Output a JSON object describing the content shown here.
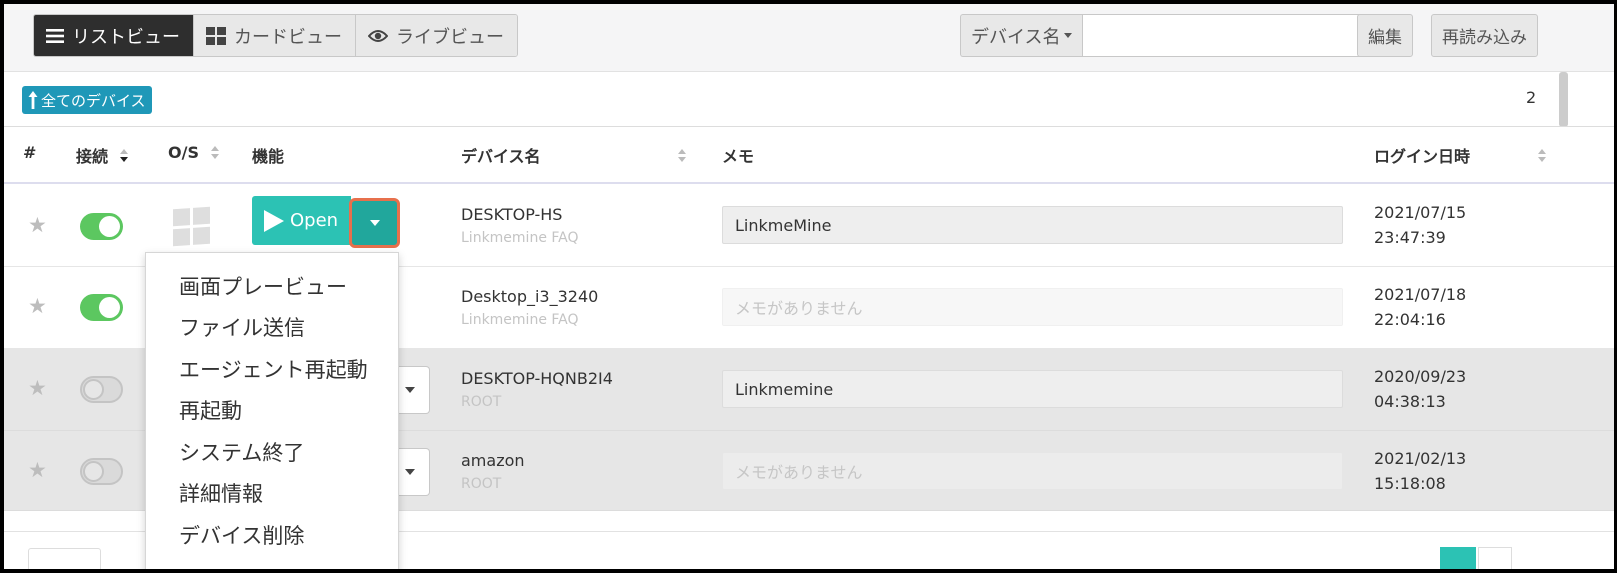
{
  "toolbar": {
    "views": [
      {
        "label": "リストビュー",
        "icon": "list-icon",
        "active": true
      },
      {
        "label": "カードビュー",
        "icon": "grid-icon",
        "active": false
      },
      {
        "label": "ライブビュー",
        "icon": "eye-icon",
        "active": false
      }
    ],
    "search_field_label": "デバイス名",
    "search_value": "",
    "edit_label": "編集",
    "reload_label": "再読み込み"
  },
  "all_devices_label": "全てのデバイス",
  "device_count": "2",
  "columns": {
    "num": "#",
    "connection": "接続",
    "os": "O/S",
    "function": "機能",
    "device_name": "デバイス名",
    "memo": "メモ",
    "login": "ログイン日時"
  },
  "open_label": "Open",
  "rows": [
    {
      "online": true,
      "name": "DESKTOP-HS",
      "sub": "Linkmemine FAQ",
      "memo": "LinkmeMine",
      "date": "2021/07/15",
      "time": "23:47:39"
    },
    {
      "online": true,
      "name": "Desktop_i3_3240",
      "sub": "Linkmemine FAQ",
      "memo": "メモがありません",
      "date": "2021/07/18",
      "time": "22:04:16"
    },
    {
      "online": false,
      "name": "DESKTOP-HQNB2I4",
      "sub": "ROOT",
      "memo": "Linkmemine",
      "date": "2020/09/23",
      "time": "04:38:13"
    },
    {
      "online": false,
      "name": "amazon",
      "sub": "ROOT",
      "memo": "メモがありません",
      "date": "2021/02/13",
      "time": "15:18:08"
    }
  ],
  "dropdown_menu": [
    "画面プレービュー",
    "ファイル送信",
    "エージェント再起動",
    "再起動",
    "システム終了",
    "詳細情報",
    "デバイス削除"
  ],
  "colors": {
    "accent": "#2cc2b4",
    "accent_dark": "#21a79c",
    "highlight_border": "#e7704c",
    "toggle_on": "#5cc760",
    "link_blue": "#1f98b8"
  }
}
